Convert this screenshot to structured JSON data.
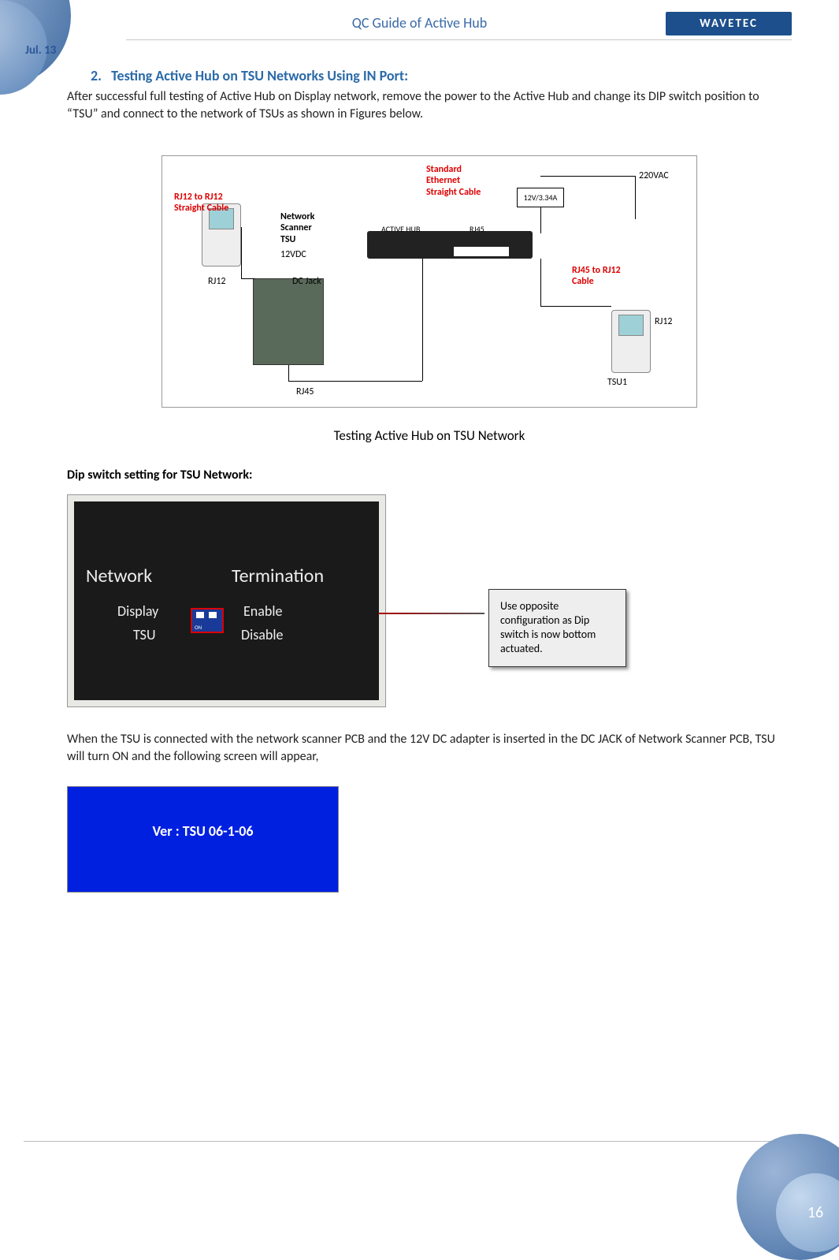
{
  "header": {
    "date": "Jul. 13",
    "title": "QC Guide of Active Hub",
    "brand": "WAVETEC"
  },
  "section": {
    "number": "2.",
    "title": "Testing Active Hub on TSU Networks Using IN Port:",
    "intro": "After successful full testing of Active Hub on Display network, remove the power to the Active Hub and change its DIP switch position to “TSU” and connect to the network of TSUs as shown in Figures below."
  },
  "diagram1": {
    "labels": {
      "rj12_cable": "RJ12 to RJ12\nStraight Cable",
      "std_eth": "Standard\nEthernet\nStraight Cable",
      "voltage": "220VAC",
      "adapter": "12V/3.34A",
      "scanner": "Network\nScanner\nTSU",
      "dc12": "12VDC",
      "rj12_left": "RJ12",
      "dcjack": "DC Jack",
      "activehub": "ACTIVE HUB",
      "rj45_top": "RJ45",
      "rj45_cable": "RJ45 to RJ12\nCable",
      "rj12_right": "RJ12",
      "rj45_bottom": "RJ45",
      "tsu1": "TSU1"
    },
    "caption": "Testing Active Hub on TSU Network"
  },
  "dip": {
    "heading": "Dip switch setting for TSU Network:",
    "network": "Network",
    "termination": "Termination",
    "display": "Display",
    "tsu": "TSU",
    "enable": "Enable",
    "disable": "Disable",
    "callout": "Use opposite configuration as Dip switch is now bottom actuated."
  },
  "after_dip": "When the TSU is connected with the network scanner PCB and the 12V DC adapter is inserted in the DC JACK of Network Scanner PCB, TSU will turn ON and the following screen will appear,",
  "screen": {
    "text": "Ver : TSU 06-1-06"
  },
  "footer": {
    "page": "16"
  }
}
